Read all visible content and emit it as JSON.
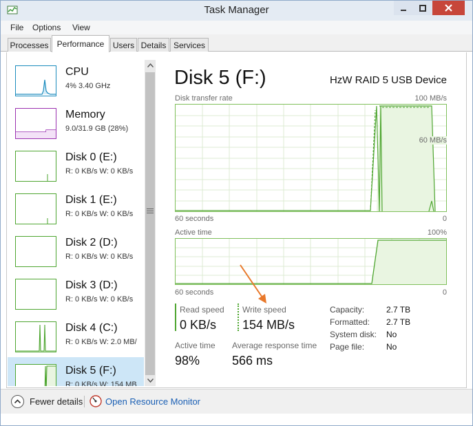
{
  "window": {
    "title": "Task Manager"
  },
  "menu": [
    "File",
    "Options",
    "View"
  ],
  "tabs": [
    "Processes",
    "Performance",
    "Users",
    "Details",
    "Services"
  ],
  "active_tab": "Performance",
  "sidebar": {
    "items": [
      {
        "name": "CPU",
        "sub": "4% 3.40 GHz",
        "color": "#1a8bbd"
      },
      {
        "name": "Memory",
        "sub": "9.0/31.9 GB (28%)",
        "color": "#9a2fb0"
      },
      {
        "name": "Disk 0 (E:)",
        "sub": "R: 0 KB/s W: 0 KB/s",
        "color": "#4da52f"
      },
      {
        "name": "Disk 1 (E:)",
        "sub": "R: 0 KB/s W: 0 KB/s",
        "color": "#4da52f"
      },
      {
        "name": "Disk 2 (D:)",
        "sub": "R: 0 KB/s W: 0 KB/s",
        "color": "#4da52f"
      },
      {
        "name": "Disk 3 (D:)",
        "sub": "R: 0 KB/s W: 0 KB/s",
        "color": "#4da52f"
      },
      {
        "name": "Disk 4 (C:)",
        "sub": "R: 0 KB/s W: 2.0 MB/",
        "color": "#4da52f"
      },
      {
        "name": "Disk 5 (F:)",
        "sub": "R: 0 KB/s W: 154 MB",
        "color": "#4da52f"
      }
    ],
    "selected_index": 7
  },
  "detail": {
    "title": "Disk 5 (F:)",
    "device": "HzW RAID 5 USB Device",
    "transfer_graph": {
      "label": "Disk transfer rate",
      "max_label": "100 MB/s",
      "mid_label": "60 MB/s",
      "x_label_left": "60 seconds",
      "x_label_right": "0"
    },
    "active_graph": {
      "label": "Active time",
      "max_label": "100%",
      "x_label_left": "60 seconds",
      "x_label_right": "0"
    },
    "stats": {
      "read_speed_label": "Read speed",
      "read_speed": "0 KB/s",
      "write_speed_label": "Write speed",
      "write_speed": "154 MB/s",
      "active_time_label": "Active time",
      "active_time": "98%",
      "avg_response_label": "Average response time",
      "avg_response": "566 ms"
    },
    "properties": [
      {
        "key": "Capacity:",
        "value": "2.7 TB"
      },
      {
        "key": "Formatted:",
        "value": "2.7 TB"
      },
      {
        "key": "System disk:",
        "value": "No"
      },
      {
        "key": "Page file:",
        "value": "No"
      }
    ]
  },
  "footer": {
    "fewer_details": "Fewer details",
    "resource_monitor": "Open Resource Monitor"
  },
  "colors": {
    "disk_green": "#4da52f",
    "graph_border": "#7fbf5a",
    "graph_fill": "#e9f5e1",
    "annotation_arrow": "#e8782a"
  }
}
